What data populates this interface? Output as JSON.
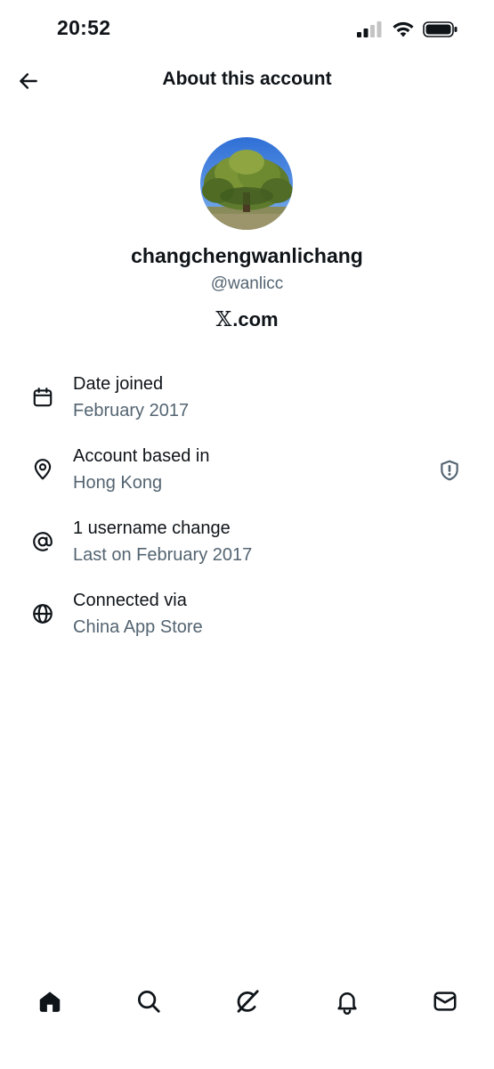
{
  "status_bar": {
    "time": "20:52"
  },
  "header": {
    "title": "About this account",
    "back_icon": "arrow-left-icon"
  },
  "profile": {
    "display_name": "changchengwanlichang",
    "handle": "@wanlicc",
    "site_logo": "𝕏",
    "site_suffix": ".com",
    "avatar_icon": "tree-photo-avatar"
  },
  "info": [
    {
      "label": "Date joined",
      "value": "February 2017",
      "icon": "calendar-icon"
    },
    {
      "label": "Account based in",
      "value": "Hong Kong",
      "icon": "location-pin-icon"
    },
    {
      "label": "1 username change",
      "value": "Last on February 2017",
      "icon": "at-sign-icon"
    },
    {
      "label": "Connected via",
      "value": "China App Store",
      "icon": "globe-icon"
    }
  ],
  "bottom_nav": [
    {
      "icon": "home-icon"
    },
    {
      "icon": "search-icon"
    },
    {
      "icon": "grok-icon"
    },
    {
      "icon": "bell-icon"
    },
    {
      "icon": "mail-icon"
    }
  ],
  "colors": {
    "primary_text": "#0f1419",
    "secondary_text": "#536471",
    "background": "#ffffff"
  }
}
